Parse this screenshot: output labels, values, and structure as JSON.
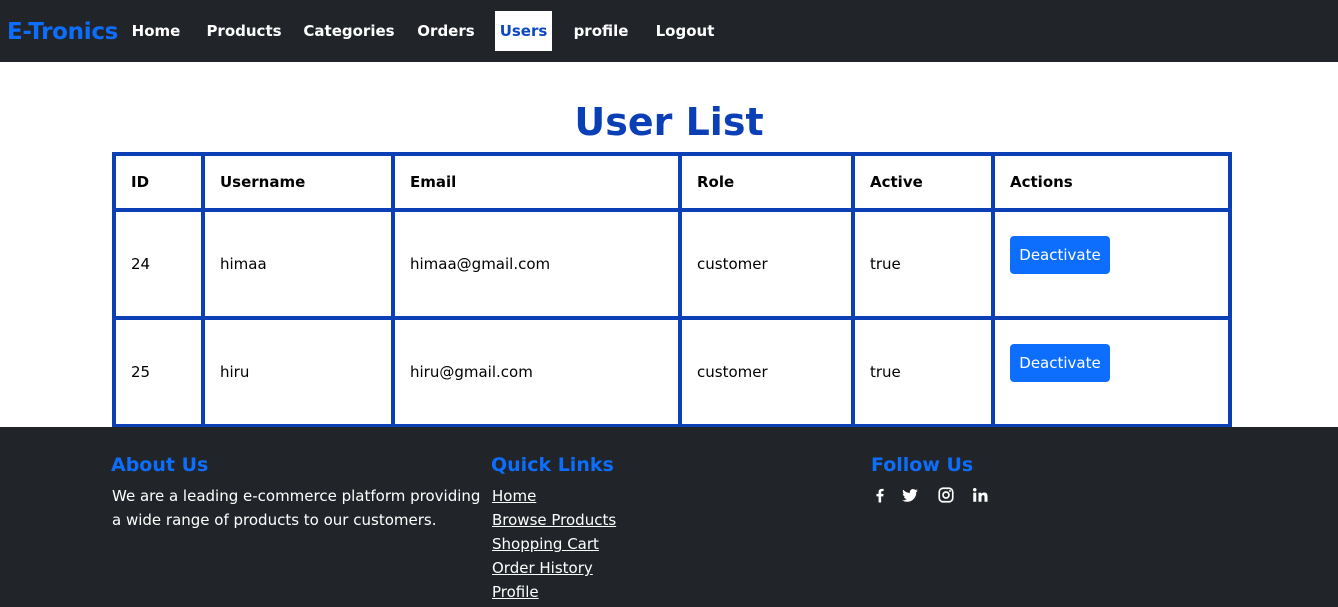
{
  "navbar": {
    "brand": "E-Tronics",
    "items": [
      {
        "label": "Home"
      },
      {
        "label": "Products"
      },
      {
        "label": "Categories"
      },
      {
        "label": "Orders"
      },
      {
        "label": "Users",
        "active": true
      },
      {
        "label": "profile"
      },
      {
        "label": "Logout"
      }
    ]
  },
  "page": {
    "title": "User List"
  },
  "table": {
    "headers": [
      "ID",
      "Username",
      "Email",
      "Role",
      "Active",
      "Actions"
    ],
    "rows": [
      {
        "id": "24",
        "username": "himaa",
        "email": "himaa@gmail.com",
        "role": "customer",
        "active": "true",
        "action": "Deactivate"
      },
      {
        "id": "25",
        "username": "hiru",
        "email": "hiru@gmail.com",
        "role": "customer",
        "active": "true",
        "action": "Deactivate"
      }
    ]
  },
  "footer": {
    "about": {
      "heading": "About Us",
      "text": "We are a leading e-commerce platform providing a wide range of products to our customers."
    },
    "quick_links": {
      "heading": "Quick Links",
      "links": [
        "Home",
        "Browse Products",
        "Shopping Cart",
        "Order History",
        "Profile"
      ]
    },
    "follow": {
      "heading": "Follow Us",
      "icons": [
        "facebook-icon",
        "twitter-icon",
        "instagram-icon",
        "linkedin-icon"
      ]
    }
  },
  "colors": {
    "dark_bg": "#212529",
    "brand_blue": "#0d6efd",
    "title_blue": "#0b3fb5",
    "white": "#ffffff"
  }
}
